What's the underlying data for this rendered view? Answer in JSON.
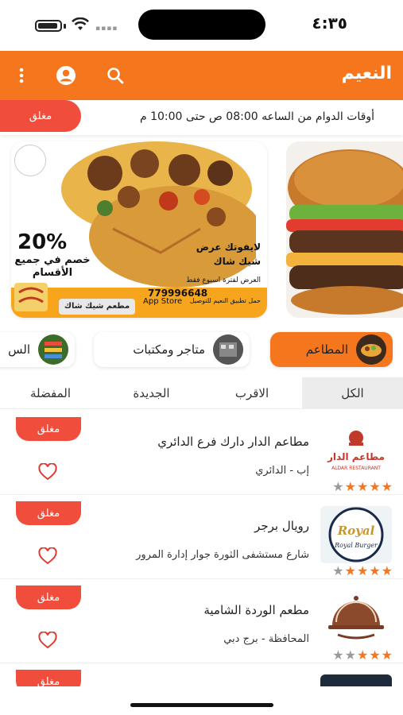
{
  "status": {
    "time": "٤:٣٥"
  },
  "header": {
    "title": "النعيم"
  },
  "hours": {
    "text": "أوقات الدوام من الساعه 08:00 ص حتى 10:00 م",
    "status": "مغلق"
  },
  "banner": {
    "discount": "20%",
    "discount_text": "خصم في جميع الأقسام",
    "offer": "لايفوتك عرض شيك شاك",
    "offer_sub": "العرض لفترة اسبوع فقط",
    "phone": "779996648",
    "shop_name": "مطعم شيك شاك",
    "app_store": "App Store",
    "tawseel": "حمل تطبيق النعيم للتوصيل"
  },
  "categories": [
    {
      "label": "المطاعم",
      "icon": "food-tray-icon",
      "active": true
    },
    {
      "label": "متاجر ومكتبات",
      "icon": "store-icon",
      "active": false
    },
    {
      "label": "الس",
      "icon": "supermarket-icon",
      "active": false
    }
  ],
  "tabs": [
    {
      "label": "الكل",
      "active": true
    },
    {
      "label": "الاقرب",
      "active": false
    },
    {
      "label": "الجديدة",
      "active": false
    },
    {
      "label": "المفضلة",
      "active": false
    }
  ],
  "restaurants": [
    {
      "name": "مطاعم الدار دارك فرع الدائري",
      "address": "إب - الدائري",
      "status": "مغلق",
      "rating": 4,
      "max_rating": 5,
      "logo_text": "مطاعم الدار",
      "logo_sub": "ALDAR RESTAURANT"
    },
    {
      "name": "رويال برجر",
      "address": "شارع مستشفى الثورة جوار إدارة المرور",
      "status": "مغلق",
      "rating": 4,
      "max_rating": 5,
      "logo_text": "Royal",
      "logo_sub": "Royal Burger"
    },
    {
      "name": "مطعم الوردة الشامية",
      "address": "المحافظة - برج دبي",
      "status": "مغلق",
      "rating": 3,
      "max_rating": 5,
      "logo_text": "",
      "logo_sub": ""
    },
    {
      "name": "",
      "address": "",
      "status": "مغلق",
      "rating": 0,
      "max_rating": 5,
      "logo_text": "",
      "logo_sub": ""
    }
  ],
  "colors": {
    "accent": "#f6761e",
    "closed": "#f04d3c",
    "star_off": "#9a9a9a"
  }
}
